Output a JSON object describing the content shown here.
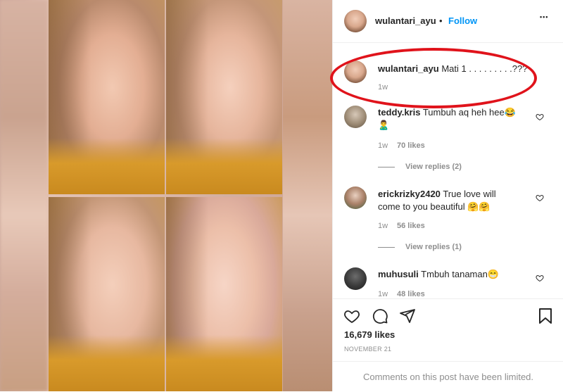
{
  "post": {
    "author": "wulantari_ayu",
    "separator": "•",
    "follow_label": "Follow",
    "more_label": "•••"
  },
  "caption": {
    "username": "wulantari_ayu",
    "text": "Mati 1 . . . . . . . . .???",
    "time": "1w"
  },
  "comments": [
    {
      "username": "teddy.kris",
      "text_line1": "Tumbuh aq heh hee😂",
      "text_line2": "🙎‍♂️",
      "time": "1w",
      "likes": "70 likes",
      "replies": "View replies (2)"
    },
    {
      "username": "erickrizky2420",
      "text_line1": "True love will",
      "text_line2": "come to you beautiful 🤗🤗",
      "time": "1w",
      "likes": "56 likes",
      "replies": "View replies (1)"
    },
    {
      "username": "muhusuli",
      "text_line1": "Tmbuh tanaman😁",
      "time": "1w",
      "likes": "48 likes"
    }
  ],
  "engagement": {
    "likes": "16,679 likes",
    "date": "NOVEMBER 21"
  },
  "footer": {
    "limited": "Comments on this post have been limited."
  },
  "colors": {
    "accent": "#0095f6",
    "annotation": "#e0131b",
    "muted": "#8e8e8e"
  }
}
